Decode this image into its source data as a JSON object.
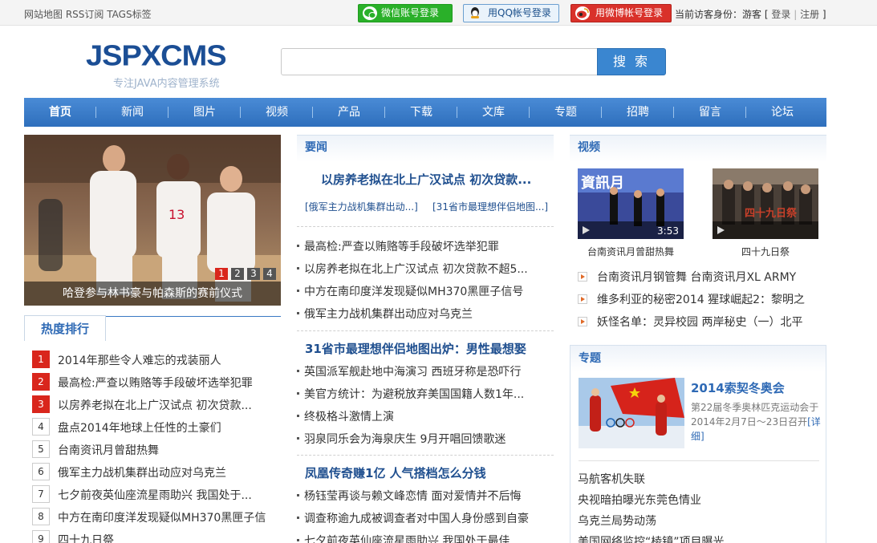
{
  "topbar": {
    "links": [
      "网站地图",
      "RSS订阅",
      "TAGS标签"
    ],
    "wechat_login": "微信账号登录",
    "qq_login": "用QQ帐号登录",
    "weibo_login": "用微博帐号登录",
    "visitor_label": "当前访客身份：游客",
    "login": "登录",
    "register": "注册",
    "bracket_open": "[",
    "bracket_close": "]",
    "divider": "|"
  },
  "header": {
    "logo": "JSPXCMS",
    "tagline": "专注JAVA内容管理系统",
    "search_value": "",
    "search_button": "搜 索"
  },
  "nav": [
    "首页",
    "新闻",
    "图片",
    "视频",
    "产品",
    "下载",
    "文库",
    "专题",
    "招聘",
    "留言",
    "论坛"
  ],
  "hero": {
    "caption": "哈登参与林书豪与帕森斯的赛前仪式",
    "pages": [
      "1",
      "2",
      "3",
      "4"
    ]
  },
  "ranking": {
    "tab": "热度排行",
    "items": [
      {
        "num": "1",
        "text": "2014年那些令人难忘的戎装丽人"
      },
      {
        "num": "2",
        "text": "最高检:严查以贿赂等手段破坏选举犯罪"
      },
      {
        "num": "3",
        "text": "以房养老拟在北上广汉试点 初次贷款..."
      },
      {
        "num": "4",
        "text": "盘点2014年地球上任性的土豪们"
      },
      {
        "num": "5",
        "text": "台南资讯月曾甜热舞"
      },
      {
        "num": "6",
        "text": "俄军主力战机集群出动应对乌克兰"
      },
      {
        "num": "7",
        "text": "七夕前夜英仙座流星雨助兴 我国处于..."
      },
      {
        "num": "8",
        "text": "中方在南印度洋发现疑似MH370黑匣子信"
      },
      {
        "num": "9",
        "text": "四十九日祭"
      }
    ]
  },
  "news": {
    "heading": "要闻",
    "headline": "以房养老拟在北上广汉试点 初次贷款...",
    "sublinks": [
      "[俄军主力战机集群出动...]",
      "[31省市最理想伴侣地图...]"
    ],
    "group1": [
      "最高检:严查以贿赂等手段破坏选举犯罪",
      "以房养老拟在北上广汉试点 初次贷款不超5...",
      "中方在南印度洋发现疑似MH370黑匣子信号",
      "俄军主力战机集群出动应对乌克兰"
    ],
    "group2_head": "31省市最理想伴侣地图出炉：男性最想娶",
    "group2": [
      "英国派军舰赴地中海演习 西班牙称是恐吓行",
      "美官方统计：为避税放弃美国国籍人数1年...",
      "终极格斗激情上演",
      "羽泉同乐会为海泉庆生 9月开唱回馈歌迷"
    ],
    "group3_head": "凤凰传奇赚1亿 人气搭档怎么分钱",
    "group3": [
      "杨钰莹再谈与赖文峰恋情 面对爱情并不后悔",
      "调查称逾九成被调查者对中国人身份感到自豪",
      "七夕前夜英仙座流星雨助兴 我国处于最佳..."
    ]
  },
  "video": {
    "heading": "视频",
    "items": [
      {
        "caption": "台南资讯月曾甜热舞",
        "duration": "3:53",
        "sign": "資訊月"
      },
      {
        "caption": "四十九日祭",
        "duration": "",
        "sign": "四十九日祭"
      }
    ],
    "links": [
      "台南资讯月钢管舞  台南资讯月XL ARMY",
      "维多利亚的秘密2014  猩球崛起2：黎明之",
      "妖怪名单：灵异校园  两岸秘史（一）北平"
    ]
  },
  "topic": {
    "heading": "专题",
    "title": "2014索契冬奥会",
    "desc": "第22届冬季奥林匹克运动会于2014年2月7日～23日召开",
    "more": "[详细]",
    "links": [
      "马航客机失联",
      "央视暗拍曝光东莞色情业",
      "乌克兰局势动荡",
      "美国网络监控“棱镜”项目曝光"
    ]
  },
  "colors": {
    "nav": "#3a7cc9",
    "brand": "#1b4e95",
    "hot_rank": "#d9261c",
    "link": "#1f4f8f"
  }
}
